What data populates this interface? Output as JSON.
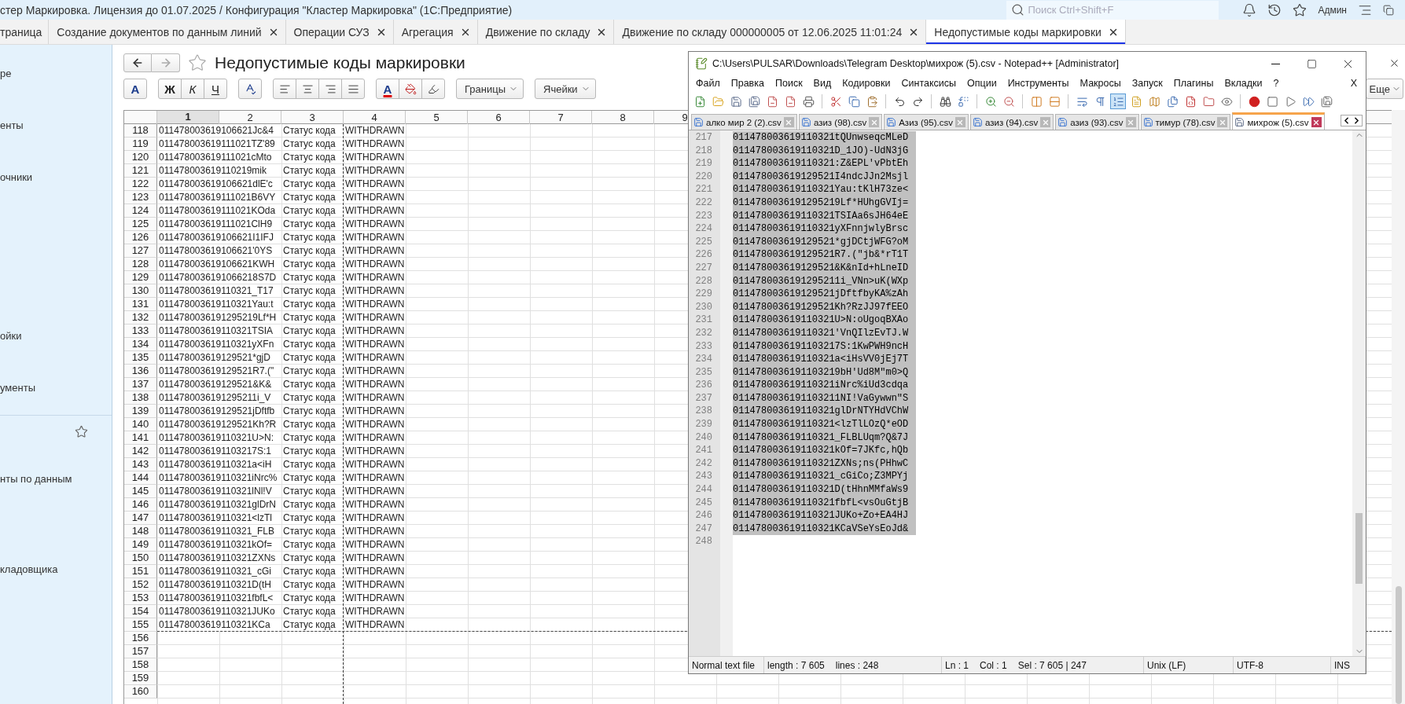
{
  "app": {
    "title": "стер Маркировка. Лицензия до 01.07.2025 / Конфигурация \"Кластер Маркировка\"  (1С:Предприятие)",
    "search": {
      "placeholder": "Поиск Ctrl+Shift+F"
    },
    "user": "Админ"
  },
  "tabs": [
    {
      "label": "траница",
      "selected": false,
      "closable": false
    },
    {
      "label": "Создание документов по данным линий",
      "selected": false,
      "closable": true
    },
    {
      "label": "Операции СУЗ",
      "selected": false,
      "closable": true
    },
    {
      "label": "Агрегация",
      "selected": false,
      "closable": true
    },
    {
      "label": "Движение по складу",
      "selected": false,
      "closable": true
    },
    {
      "label": "Движение по складу 000000005 от 12.06.2025 11:01:24",
      "selected": false,
      "closable": true
    },
    {
      "label": "Недопустимые коды маркировки",
      "selected": true,
      "closable": true
    }
  ],
  "sidebar": {
    "items": [
      {
        "label": "ре"
      },
      {
        "label": "енты"
      },
      {
        "label": "очники"
      },
      {
        "label": "ойки"
      },
      {
        "label": "ументы"
      }
    ],
    "favorites": [
      {
        "label": "нты по данным"
      },
      {
        "label": "кладовщика"
      }
    ]
  },
  "page": {
    "title": "Недопустимые коды маркировки",
    "favorite": false,
    "more_button": "Еще"
  },
  "format_toolbar": {
    "font_button": "A",
    "style_buttons": [
      "Ж",
      "К",
      "Ч"
    ],
    "text_color_button": "A",
    "dropdowns": [
      "Границы",
      "Ячейки"
    ]
  },
  "sheet": {
    "columns": [
      {
        "label": "1",
        "selected": true
      },
      {
        "label": "2",
        "selected": false
      },
      {
        "label": "3",
        "selected": false
      },
      {
        "label": "4",
        "selected": false
      },
      {
        "label": "5",
        "selected": false
      },
      {
        "label": "6",
        "selected": false
      },
      {
        "label": "7",
        "selected": false
      },
      {
        "label": "8",
        "selected": false
      },
      {
        "label": "9",
        "selected": false
      }
    ],
    "rows": [
      {
        "number": "118",
        "column_1": "011478003619106621Jc&4",
        "column_3": "Статус кода",
        "column_4": "WITHDRAWN"
      },
      {
        "number": "119",
        "column_1": "011478003619111021TZ'89",
        "column_3": "Статус кода",
        "column_4": "WITHDRAWN"
      },
      {
        "number": "120",
        "column_1": "011478003619111021cMto",
        "column_3": "Статус кода",
        "column_4": "WITHDRAWN"
      },
      {
        "number": "121",
        "column_1": "011478003619110219mik",
        "column_3": "Статус кода",
        "column_4": "WITHDRAWN"
      },
      {
        "number": "122",
        "column_1": "011478003619106621dlE'c",
        "column_3": "Статус кода",
        "column_4": "WITHDRAWN"
      },
      {
        "number": "123",
        "column_1": "011478003619111021B6VY",
        "column_3": "Статус кода",
        "column_4": "WITHDRAWN"
      },
      {
        "number": "124",
        "column_1": "011478003619111021KOda",
        "column_3": "Статус кода",
        "column_4": "WITHDRAWN"
      },
      {
        "number": "125",
        "column_1": "011478003619111021ClH9",
        "column_3": "Статус кода",
        "column_4": "WITHDRAWN"
      },
      {
        "number": "126",
        "column_1": "011478003619106621I1IFJ",
        "column_3": "Статус кода",
        "column_4": "WITHDRAWN"
      },
      {
        "number": "127",
        "column_1": "011478003619106621'0YS",
        "column_3": "Статус кода",
        "column_4": "WITHDRAWN"
      },
      {
        "number": "128",
        "column_1": "011478003619106621KWH",
        "column_3": "Статус кода",
        "column_4": "WITHDRAWN"
      },
      {
        "number": "129",
        "column_1": "0114780036191066218S7D",
        "column_3": "Статус кода",
        "column_4": "WITHDRAWN"
      },
      {
        "number": "130",
        "column_1": "011478003619110321_T17",
        "column_3": "Статус кода",
        "column_4": "WITHDRAWN"
      },
      {
        "number": "131",
        "column_1": "011478003619110321Yau:t",
        "column_3": "Статус кода",
        "column_4": "WITHDRAWN"
      },
      {
        "number": "132",
        "column_1": "0114780036191295219Lf*H",
        "column_3": "Статус кода",
        "column_4": "WITHDRAWN"
      },
      {
        "number": "133",
        "column_1": "011478003619110321TSIA",
        "column_3": "Статус кода",
        "column_4": "WITHDRAWN"
      },
      {
        "number": "134",
        "column_1": "011478003619110321yXFn",
        "column_3": "Статус кода",
        "column_4": "WITHDRAWN"
      },
      {
        "number": "135",
        "column_1": "011478003619129521*gjD",
        "column_3": "Статус кода",
        "column_4": "WITHDRAWN"
      },
      {
        "number": "136",
        "column_1": "011478003619129521R7.(\"",
        "column_3": "Статус кода",
        "column_4": "WITHDRAWN"
      },
      {
        "number": "137",
        "column_1": "011478003619129521&K&",
        "column_3": "Статус кода",
        "column_4": "WITHDRAWN"
      },
      {
        "number": "138",
        "column_1": "0114780036191295211i_V",
        "column_3": "Статус кода",
        "column_4": "WITHDRAWN"
      },
      {
        "number": "139",
        "column_1": "011478003619129521jDftfb",
        "column_3": "Статус кода",
        "column_4": "WITHDRAWN"
      },
      {
        "number": "140",
        "column_1": "011478003619129521Kh?R",
        "column_3": "Статус кода",
        "column_4": "WITHDRAWN"
      },
      {
        "number": "141",
        "column_1": "011478003619110321U>N:",
        "column_3": "Статус кода",
        "column_4": "WITHDRAWN"
      },
      {
        "number": "142",
        "column_1": "0114780036191103217S:1",
        "column_3": "Статус кода",
        "column_4": "WITHDRAWN"
      },
      {
        "number": "143",
        "column_1": "011478003619110321a<iH",
        "column_3": "Статус кода",
        "column_4": "WITHDRAWN"
      },
      {
        "number": "144",
        "column_1": "011478003619110321iNrc%",
        "column_3": "Статус кода",
        "column_4": "WITHDRAWN"
      },
      {
        "number": "145",
        "column_1": "011478003619110321lNl!V",
        "column_3": "Статус кода",
        "column_4": "WITHDRAWN"
      },
      {
        "number": "146",
        "column_1": "011478003619110321glDrN",
        "column_3": "Статус кода",
        "column_4": "WITHDRAWN"
      },
      {
        "number": "147",
        "column_1": "011478003619110321<lzTl",
        "column_3": "Статус кода",
        "column_4": "WITHDRAWN"
      },
      {
        "number": "148",
        "column_1": "011478003619110321_FLB",
        "column_3": "Статус кода",
        "column_4": "WITHDRAWN"
      },
      {
        "number": "149",
        "column_1": "011478003619110321kOf=",
        "column_3": "Статус кода",
        "column_4": "WITHDRAWN"
      },
      {
        "number": "150",
        "column_1": "011478003619110321ZXNs",
        "column_3": "Статус кода",
        "column_4": "WITHDRAWN"
      },
      {
        "number": "151",
        "column_1": "011478003619110321_cGi",
        "column_3": "Статус кода",
        "column_4": "WITHDRAWN"
      },
      {
        "number": "152",
        "column_1": "011478003619110321D(tH",
        "column_3": "Статус кода",
        "column_4": "WITHDRAWN"
      },
      {
        "number": "153",
        "column_1": "011478003619110321fbfL<",
        "column_3": "Статус кода",
        "column_4": "WITHDRAWN"
      },
      {
        "number": "154",
        "column_1": "011478003619110321JUKo",
        "column_3": "Статус кода",
        "column_4": "WITHDRAWN"
      },
      {
        "number": "155",
        "column_1": "011478003619110321KCa",
        "column_3": "Статус кода",
        "column_4": "WITHDRAWN"
      },
      {
        "number": "156"
      },
      {
        "number": "157"
      },
      {
        "number": "158"
      },
      {
        "number": "159"
      },
      {
        "number": "160"
      }
    ]
  },
  "notepad": {
    "title": "C:\\Users\\PULSAR\\Downloads\\Telegram Desktop\\михрож (5).csv - Notepad++ [Administrator]",
    "menu": [
      "Файл",
      "Правка",
      "Поиск",
      "Вид",
      "Кодировки",
      "Синтаксисы",
      "Опции",
      "Инструменты",
      "Макросы",
      "Запуск",
      "Плагины",
      "Вкладки",
      "?"
    ],
    "menu_close": "X",
    "toolbar": [
      {
        "selected": false
      },
      {
        "selected": false
      },
      {
        "selected": false
      },
      {
        "selected": false
      },
      {
        "selected": false
      },
      {
        "selected": false
      },
      {
        "selected": false
      },
      {
        "selected": false
      },
      {
        "selected": false
      },
      {
        "selected": false
      },
      {
        "selected": false
      },
      {
        "selected": false
      },
      {
        "selected": false
      },
      {
        "selected": false
      },
      {
        "selected": false
      },
      {
        "selected": false
      },
      {
        "selected": false
      },
      {
        "selected": false
      },
      {
        "selected": false
      },
      {
        "selected": false
      },
      {
        "selected": true
      },
      {
        "selected": false
      },
      {
        "selected": false
      },
      {
        "selected": false
      },
      {
        "selected": false
      },
      {
        "selected": false
      },
      {
        "selected": false
      },
      {
        "selected": false
      },
      {
        "selected": false
      },
      {
        "selected": false
      },
      {
        "selected": false
      },
      {
        "selected": false
      }
    ],
    "tabs": [
      {
        "label": "алко мир 2 (2).csv",
        "selected": false
      },
      {
        "label": "азиз (98).csv",
        "selected": false
      },
      {
        "label": "Азиз (95).csv",
        "selected": false
      },
      {
        "label": "азиз (94).csv",
        "selected": false
      },
      {
        "label": "азиз (93).csv",
        "selected": false
      },
      {
        "label": "тимур (78).csv",
        "selected": false
      },
      {
        "label": "михрож (5).csv",
        "selected": true
      }
    ],
    "lines": [
      {
        "number": "217",
        "text": "011478003619110321tQUnwseqcMLeD",
        "selected": true
      },
      {
        "number": "218",
        "text": "011478003619110321D_1JO)-UdN3jG",
        "selected": true
      },
      {
        "number": "219",
        "text": "011478003619110321:Z&EPL'vPbtEh",
        "selected": true
      },
      {
        "number": "220",
        "text": "011478003619129521I4ndcJJn2Msjl",
        "selected": true
      },
      {
        "number": "221",
        "text": "011478003619110321Yau:tKlH73ze<",
        "selected": true
      },
      {
        "number": "222",
        "text": "0114780036191295219Lf*HUhgGVIj=",
        "selected": true
      },
      {
        "number": "223",
        "text": "011478003619110321TSIAa6sJH64eE",
        "selected": true
      },
      {
        "number": "224",
        "text": "011478003619110321yXFnnjwlyBrsc",
        "selected": true
      },
      {
        "number": "225",
        "text": "011478003619129521*gjDCtjWFG?oM",
        "selected": true
      },
      {
        "number": "226",
        "text": "011478003619129521R7.(\"jb&*rT1T",
        "selected": true
      },
      {
        "number": "227",
        "text": "011478003619129521&K&nId+hLneID",
        "selected": true
      },
      {
        "number": "228",
        "text": "0114780036191295211i_VNn>uK(WXp",
        "selected": true
      },
      {
        "number": "229",
        "text": "011478003619129521jDftfbyKA%zAh",
        "selected": true
      },
      {
        "number": "230",
        "text": "011478003619129521Kh?RzJJ97fEEO",
        "selected": true
      },
      {
        "number": "231",
        "text": "011478003619110321U>N:oUgoqBXAo",
        "selected": true
      },
      {
        "number": "232",
        "text": "011478003619110321'VnQIlzEvTJ.W",
        "selected": true
      },
      {
        "number": "233",
        "text": "0114780036191103217S:1KwPWH9ncH",
        "selected": true
      },
      {
        "number": "234",
        "text": "011478003619110321a<iHsVV0jEj7T",
        "selected": true
      },
      {
        "number": "235",
        "text": "0114780036191103219bH'Ud8M\"m0>Q",
        "selected": true
      },
      {
        "number": "236",
        "text": "011478003619110321iNrc%iUd3cdqa",
        "selected": true
      },
      {
        "number": "237",
        "text": "0114780036191103211NI!VaGywwn\"S",
        "selected": true
      },
      {
        "number": "238",
        "text": "011478003619110321glDrNTYHdVChW",
        "selected": true
      },
      {
        "number": "239",
        "text": "011478003619110321<lzTlLOzQ*eOD",
        "selected": true
      },
      {
        "number": "240",
        "text": "011478003619110321_FLBLUqm?Q&7J",
        "selected": true
      },
      {
        "number": "241",
        "text": "011478003619110321kOf=7JKfc,hQb",
        "selected": true
      },
      {
        "number": "242",
        "text": "011478003619110321ZXNs;ns(PHhwC",
        "selected": true
      },
      {
        "number": "243",
        "text": "011478003619110321_cGiCo;Z3MPYj",
        "selected": true
      },
      {
        "number": "244",
        "text": "011478003619110321D(tHhnMMfaWs9",
        "selected": true
      },
      {
        "number": "245",
        "text": "011478003619110321fbfL<vsOuGtjB",
        "selected": true
      },
      {
        "number": "246",
        "text": "011478003619110321JUKo+Zo+EA4HJ",
        "selected": true
      },
      {
        "number": "247",
        "text": "011478003619110321KCaVSeYsEoJd&",
        "selected": true
      },
      {
        "number": "248",
        "selected": false
      }
    ],
    "status": {
      "file_type": "Normal text file",
      "length": "length : 7 605",
      "lines": "lines : 248",
      "line": "Ln : 1",
      "column": "Col : 1",
      "selection": "Sel : 7 605 | 247",
      "eol": "Unix (LF)",
      "encoding": "UTF-8",
      "mode": "INS"
    }
  }
}
